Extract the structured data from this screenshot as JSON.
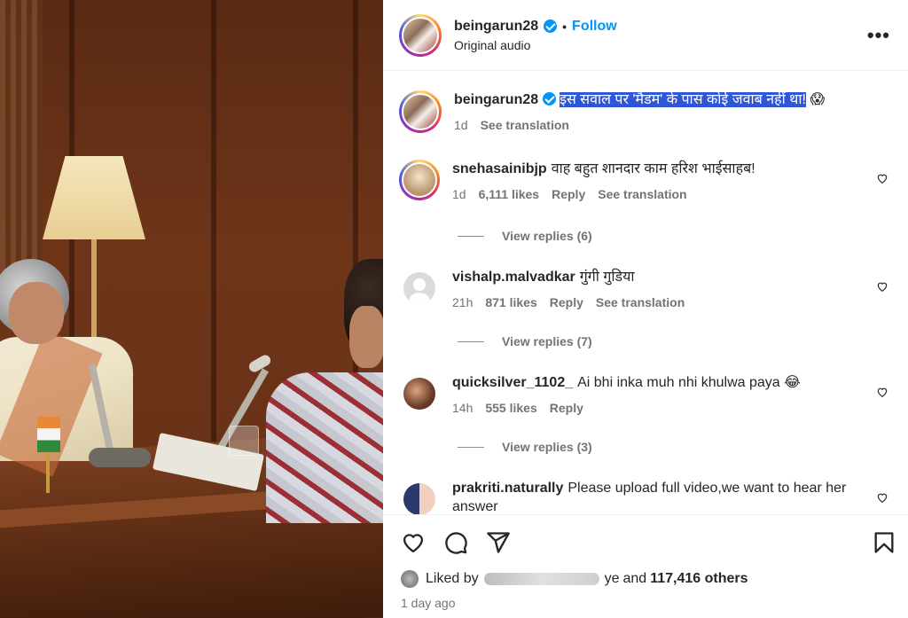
{
  "post": {
    "username": "beingarun28",
    "follow_label": "Follow",
    "subtitle": "Original audio",
    "more_label": "•••",
    "caption": "इस सवाल पर 'मैडम' के पास कोई जवाब नहीं था!",
    "caption_emoji": "😱",
    "caption_age": "1d",
    "see_translation": "See translation"
  },
  "comments": [
    {
      "username": "snehasainibjp",
      "text": "वाह बहुत शानदार काम हरिश भाईसाहब!",
      "age": "1d",
      "likes": "6,111 likes",
      "reply": "Reply",
      "translation": "See translation",
      "view_replies": "View replies (6)"
    },
    {
      "username": "vishalp.malvadkar",
      "text": "गुंगी गुडिया",
      "age": "21h",
      "likes": "871 likes",
      "reply": "Reply",
      "translation": "See translation",
      "view_replies": "View replies (7)"
    },
    {
      "username": "quicksilver_1102_",
      "text": "Ai bhi inka muh nhi khulwa paya 😂",
      "age": "14h",
      "likes": "555 likes",
      "reply": "Reply",
      "view_replies": "View replies (3)"
    },
    {
      "username": "prakriti.naturally",
      "text": "Please upload full video,we want to hear her answer"
    }
  ],
  "likes_bar": {
    "liked_by": "Liked by",
    "partial_name": "ye",
    "and": "and",
    "others": "117,416 others",
    "time_ago": "1 day ago"
  },
  "icons": [
    "heart-icon",
    "comment-icon",
    "share-icon",
    "bookmark-icon",
    "more-icon",
    "verified-icon"
  ],
  "colors": {
    "accent": "#0095f6",
    "highlight": "#2f56d6",
    "muted": "#737373"
  }
}
